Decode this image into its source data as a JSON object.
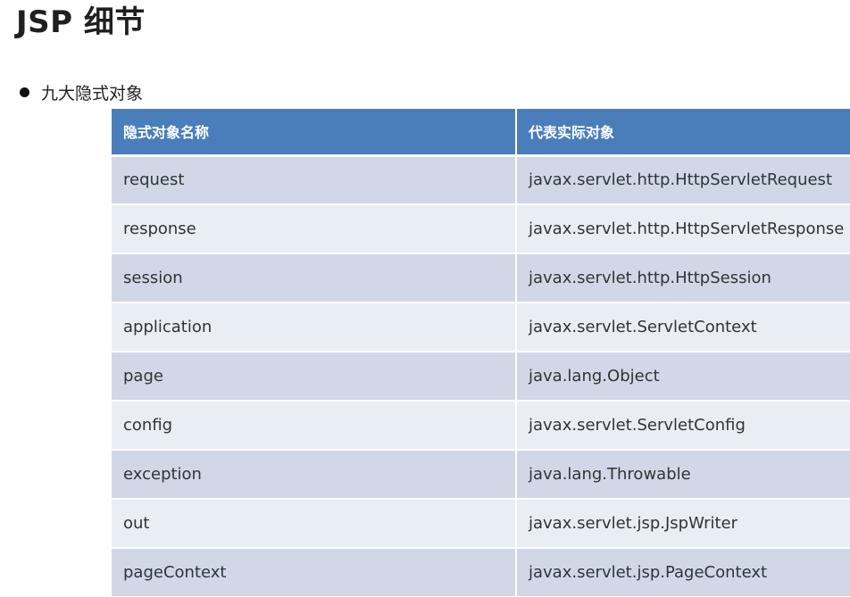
{
  "page": {
    "title": "JSP 细节",
    "bullet": "九大隐式对象"
  },
  "table": {
    "headers": [
      "隐式对象名称",
      "代表实际对象"
    ],
    "rows": [
      [
        "request",
        "javax.servlet.http.HttpServletRequest"
      ],
      [
        "response",
        "javax.servlet.http.HttpServletResponse"
      ],
      [
        "session",
        "javax.servlet.http.HttpSession"
      ],
      [
        "application",
        "javax.servlet.ServletContext"
      ],
      [
        "page",
        "java.lang.Object"
      ],
      [
        "config",
        "javax.servlet.ServletConfig"
      ],
      [
        "exception",
        "java.lang.Throwable"
      ],
      [
        "out",
        "javax.servlet.jsp.JspWriter"
      ],
      [
        "pageContext",
        "javax.servlet.jsp.PageContext"
      ]
    ]
  },
  "colors": {
    "header_bg": "#4a7ebb",
    "row_odd": "#d0d8e8",
    "row_even": "#e9edf4"
  }
}
